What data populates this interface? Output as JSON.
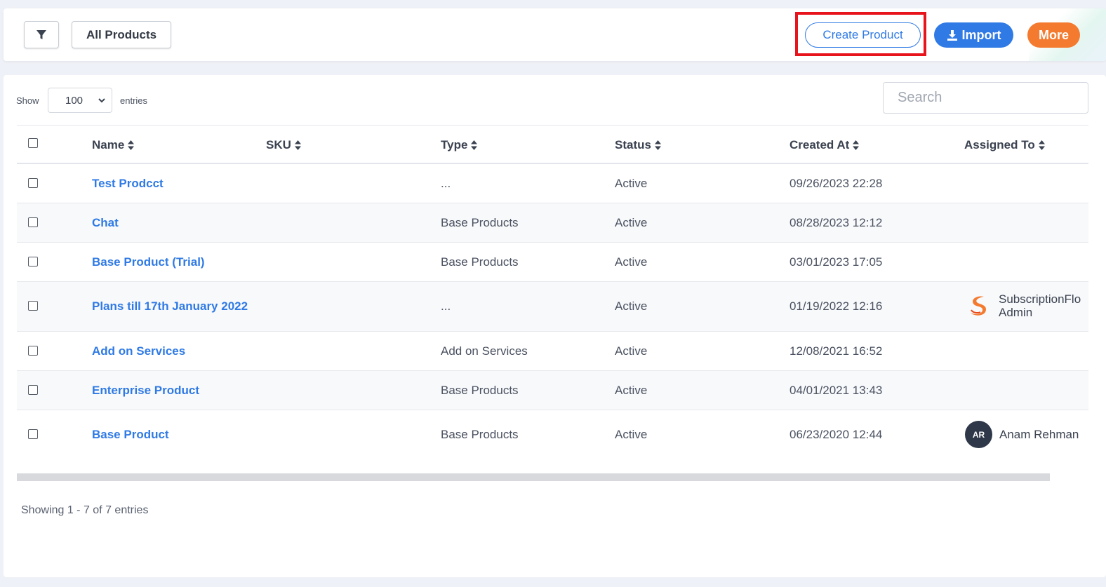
{
  "toolbar": {
    "all_products_label": "All Products",
    "create_product_label": "Create Product",
    "import_label": "Import",
    "more_label": "More",
    "colors": {
      "primary": "#2f7ae5",
      "more": "#f47a2f",
      "highlight": "#e8141c"
    }
  },
  "controls": {
    "show_label": "Show",
    "entries_value": "100",
    "entries_label": "entries",
    "search_placeholder": "Search"
  },
  "table": {
    "columns": [
      "Name",
      "SKU",
      "Type",
      "Status",
      "Created At",
      "Assigned To"
    ],
    "rows": [
      {
        "name": "Test Prodcct",
        "sku": "",
        "type": "...",
        "status": "Active",
        "created": "09/26/2023 22:28",
        "assigned": ""
      },
      {
        "name": "Chat",
        "sku": "",
        "type": "Base Products",
        "status": "Active",
        "created": "08/28/2023 12:12",
        "assigned": ""
      },
      {
        "name": "Base Product (Trial)",
        "sku": "",
        "type": "Base Products",
        "status": "Active",
        "created": "03/01/2023 17:05",
        "assigned": ""
      },
      {
        "name": "Plans till 17th January 2022",
        "sku": "",
        "type": "...",
        "status": "Active",
        "created": "01/19/2022 12:16",
        "assigned": "SubscriptionFlo",
        "assigned2": "Admin"
      },
      {
        "name": "Add on Services",
        "sku": "",
        "type": "Add on Services",
        "status": "Active",
        "created": "12/08/2021 16:52",
        "assigned": ""
      },
      {
        "name": "Enterprise Product",
        "sku": "",
        "type": "Base Products",
        "status": "Active",
        "created": "04/01/2021 13:43",
        "assigned": ""
      },
      {
        "name": "Base Product",
        "sku": "",
        "type": "Base Products",
        "status": "Active",
        "created": "06/23/2020 12:44",
        "assigned": "Anam Rehman",
        "avatar_initials": "AR"
      }
    ]
  },
  "footer": {
    "info": "Showing 1 - 7 of 7 entries"
  }
}
